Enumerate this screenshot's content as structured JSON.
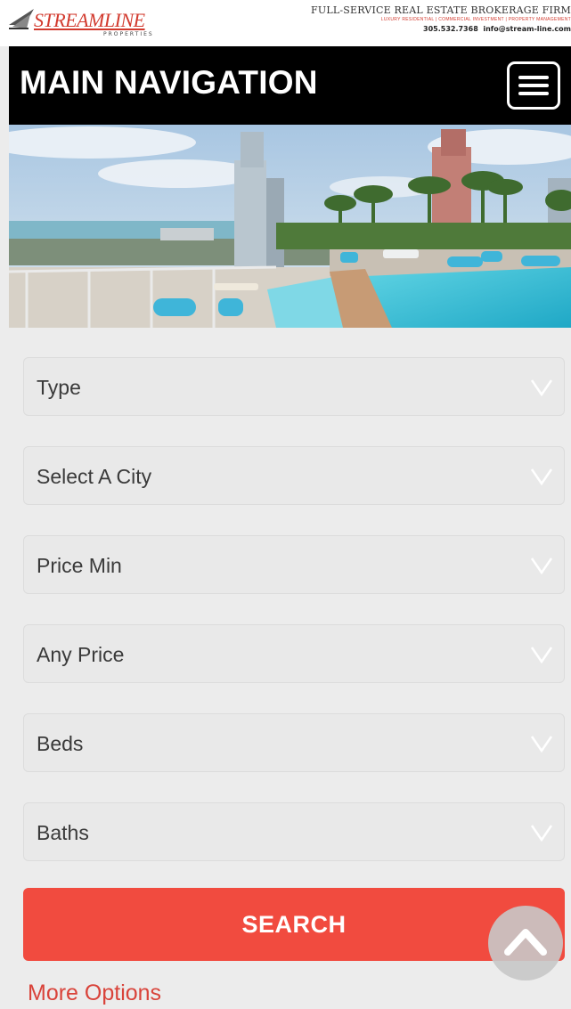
{
  "header": {
    "logo_word": "STREAMLINE",
    "logo_sub": "PROPERTIES",
    "tagline": "FULL-SERVICE REAL ESTATE BROKERAGE FIRM",
    "services": "LUXURY RESIDENTIAL | COMMERCIAL INVESTMENT | PROPERTY MANAGEMENT",
    "phone": "305.532.7368",
    "email": "info@stream-line.com"
  },
  "nav": {
    "title": "MAIN NAVIGATION",
    "menu_icon": "hamburger-menu-icon"
  },
  "search_form": {
    "fields": [
      {
        "label": "Type"
      },
      {
        "label": "Select A City"
      },
      {
        "label": "Price Min"
      },
      {
        "label": "Any Price"
      },
      {
        "label": "Beds"
      },
      {
        "label": "Baths"
      }
    ],
    "search_label": "SEARCH",
    "more_options": "More Options"
  },
  "colors": {
    "accent": "#f14b3f",
    "nav_bg": "#000000",
    "page_bg": "#ececec",
    "link": "#d9433a"
  },
  "icons": {
    "caret": "chevron-down-icon",
    "scroll_top": "chevron-up-icon"
  }
}
